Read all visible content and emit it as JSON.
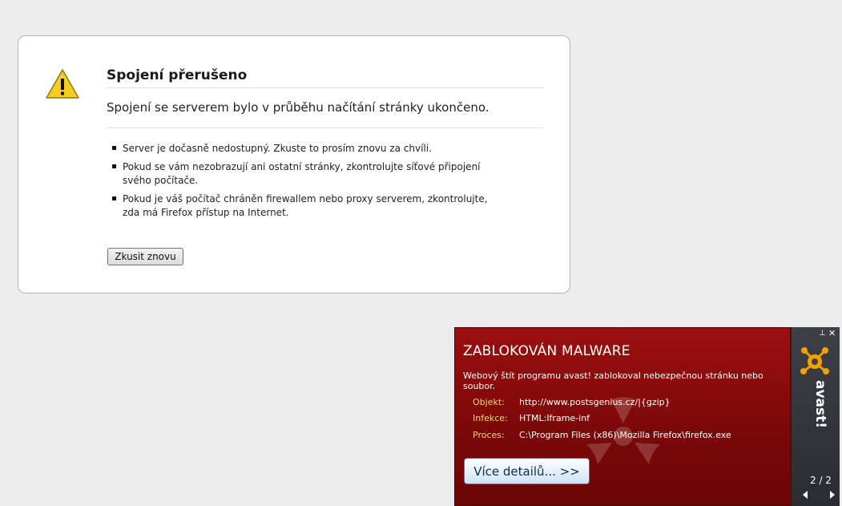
{
  "error_page": {
    "title": "Spojení přerušeno",
    "short_desc": "Spojení se serverem bylo v průběhu načítání stránky ukončeno.",
    "items": [
      "Server je dočasně nedostupný. Zkuste to prosím znovu za chvíli.",
      "Pokud se vám nezobrazují ani ostatní stránky, zkontrolujte síťové připojení svého počítače.",
      "Pokud je váš počítač chráněn firewallem nebo proxy serverem, zkontrolujte, zda má Firefox přístup na Internet."
    ],
    "retry_label": "Zkusit znovu"
  },
  "avast_popup": {
    "title": "ZABLOKOVÁN MALWARE",
    "message": "Webový štít programu avast! zablokoval nebezpečnou stránku nebo soubor.",
    "object_label": "Objekt:",
    "object_value": "http://www.postsgenius.cz/|{gzip}",
    "infection_label": "Infekce:",
    "infection_value": "HTML:Iframe-inf",
    "process_label": "Proces:",
    "process_value": "C:\\Program Files (x86)\\Mozilla Firefox\\firefox.exe",
    "details_label": "Více detailů... >>",
    "brand": "avast!",
    "pager": "2 / 2",
    "pin_glyph": "⊥",
    "close_glyph": "✕",
    "colors": {
      "panel": "#8b0b0b",
      "accent_label": "#f5d77a",
      "logo_orange": "#f5a100"
    }
  }
}
